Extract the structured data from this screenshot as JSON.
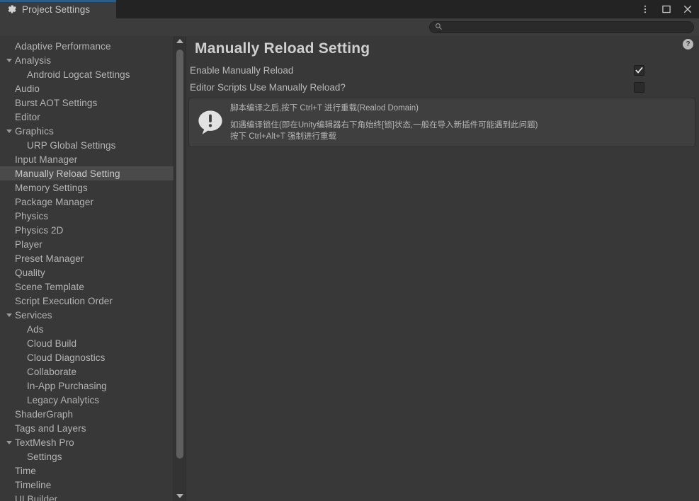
{
  "window": {
    "tab_label": "Project Settings",
    "tab_icon": "gear-icon",
    "controls": [
      {
        "name": "more-options-icon",
        "glyph": "kebab-menu"
      },
      {
        "name": "maximize-icon",
        "glyph": "square"
      },
      {
        "name": "close-icon",
        "glyph": "x"
      }
    ]
  },
  "search": {
    "value": "",
    "placeholder": "",
    "icon": "search-icon"
  },
  "sidebar": {
    "items": [
      {
        "label": "Adaptive Performance",
        "indent": 0,
        "expandable": false,
        "selected": false
      },
      {
        "label": "Analysis",
        "indent": 0,
        "expandable": true,
        "selected": false
      },
      {
        "label": "Android Logcat Settings",
        "indent": 1,
        "expandable": false,
        "selected": false
      },
      {
        "label": "Audio",
        "indent": 0,
        "expandable": false,
        "selected": false
      },
      {
        "label": "Burst AOT Settings",
        "indent": 0,
        "expandable": false,
        "selected": false
      },
      {
        "label": "Editor",
        "indent": 0,
        "expandable": false,
        "selected": false
      },
      {
        "label": "Graphics",
        "indent": 0,
        "expandable": true,
        "selected": false
      },
      {
        "label": "URP Global Settings",
        "indent": 1,
        "expandable": false,
        "selected": false
      },
      {
        "label": "Input Manager",
        "indent": 0,
        "expandable": false,
        "selected": false
      },
      {
        "label": "Manually Reload Setting",
        "indent": 0,
        "expandable": false,
        "selected": true
      },
      {
        "label": "Memory Settings",
        "indent": 0,
        "expandable": false,
        "selected": false
      },
      {
        "label": "Package Manager",
        "indent": 0,
        "expandable": false,
        "selected": false
      },
      {
        "label": "Physics",
        "indent": 0,
        "expandable": false,
        "selected": false
      },
      {
        "label": "Physics 2D",
        "indent": 0,
        "expandable": false,
        "selected": false
      },
      {
        "label": "Player",
        "indent": 0,
        "expandable": false,
        "selected": false
      },
      {
        "label": "Preset Manager",
        "indent": 0,
        "expandable": false,
        "selected": false
      },
      {
        "label": "Quality",
        "indent": 0,
        "expandable": false,
        "selected": false
      },
      {
        "label": "Scene Template",
        "indent": 0,
        "expandable": false,
        "selected": false
      },
      {
        "label": "Script Execution Order",
        "indent": 0,
        "expandable": false,
        "selected": false
      },
      {
        "label": "Services",
        "indent": 0,
        "expandable": true,
        "selected": false
      },
      {
        "label": "Ads",
        "indent": 1,
        "expandable": false,
        "selected": false
      },
      {
        "label": "Cloud Build",
        "indent": 1,
        "expandable": false,
        "selected": false
      },
      {
        "label": "Cloud Diagnostics",
        "indent": 1,
        "expandable": false,
        "selected": false
      },
      {
        "label": "Collaborate",
        "indent": 1,
        "expandable": false,
        "selected": false
      },
      {
        "label": "In-App Purchasing",
        "indent": 1,
        "expandable": false,
        "selected": false
      },
      {
        "label": "Legacy Analytics",
        "indent": 1,
        "expandable": false,
        "selected": false
      },
      {
        "label": "ShaderGraph",
        "indent": 0,
        "expandable": false,
        "selected": false
      },
      {
        "label": "Tags and Layers",
        "indent": 0,
        "expandable": false,
        "selected": false
      },
      {
        "label": "TextMesh Pro",
        "indent": 0,
        "expandable": true,
        "selected": false
      },
      {
        "label": "Settings",
        "indent": 1,
        "expandable": false,
        "selected": false
      },
      {
        "label": "Time",
        "indent": 0,
        "expandable": false,
        "selected": false
      },
      {
        "label": "Timeline",
        "indent": 0,
        "expandable": false,
        "selected": false
      },
      {
        "label": "UI Builder",
        "indent": 0,
        "expandable": false,
        "selected": false
      }
    ],
    "scrollbar": {
      "up_arrow": "arrow-up-icon",
      "down_arrow": "arrow-down-icon"
    }
  },
  "main": {
    "title": "Manually Reload Setting",
    "help_glyph": "?",
    "settings": [
      {
        "label": "Enable Manually Reload",
        "checked": true
      },
      {
        "label": "Editor Scripts Use Manually Reload?",
        "checked": false
      }
    ],
    "info": {
      "icon": "info-exclamation-icon",
      "line1": "脚本编译之后,按下 Ctrl+T 进行重载(Realod Domain)",
      "line2": "如遇编译锁住(即在Unity编辑器右下角始终[锁]状态,一般在导入新插件可能遇到此问题)",
      "line3": "按下 Ctrl+Alt+T 强制进行重载"
    }
  },
  "colors": {
    "accent": "#2c5d87",
    "panel": "#383838",
    "tabbar": "#232323",
    "selection": "#4a4a4a",
    "text": "#b4b4b4"
  }
}
